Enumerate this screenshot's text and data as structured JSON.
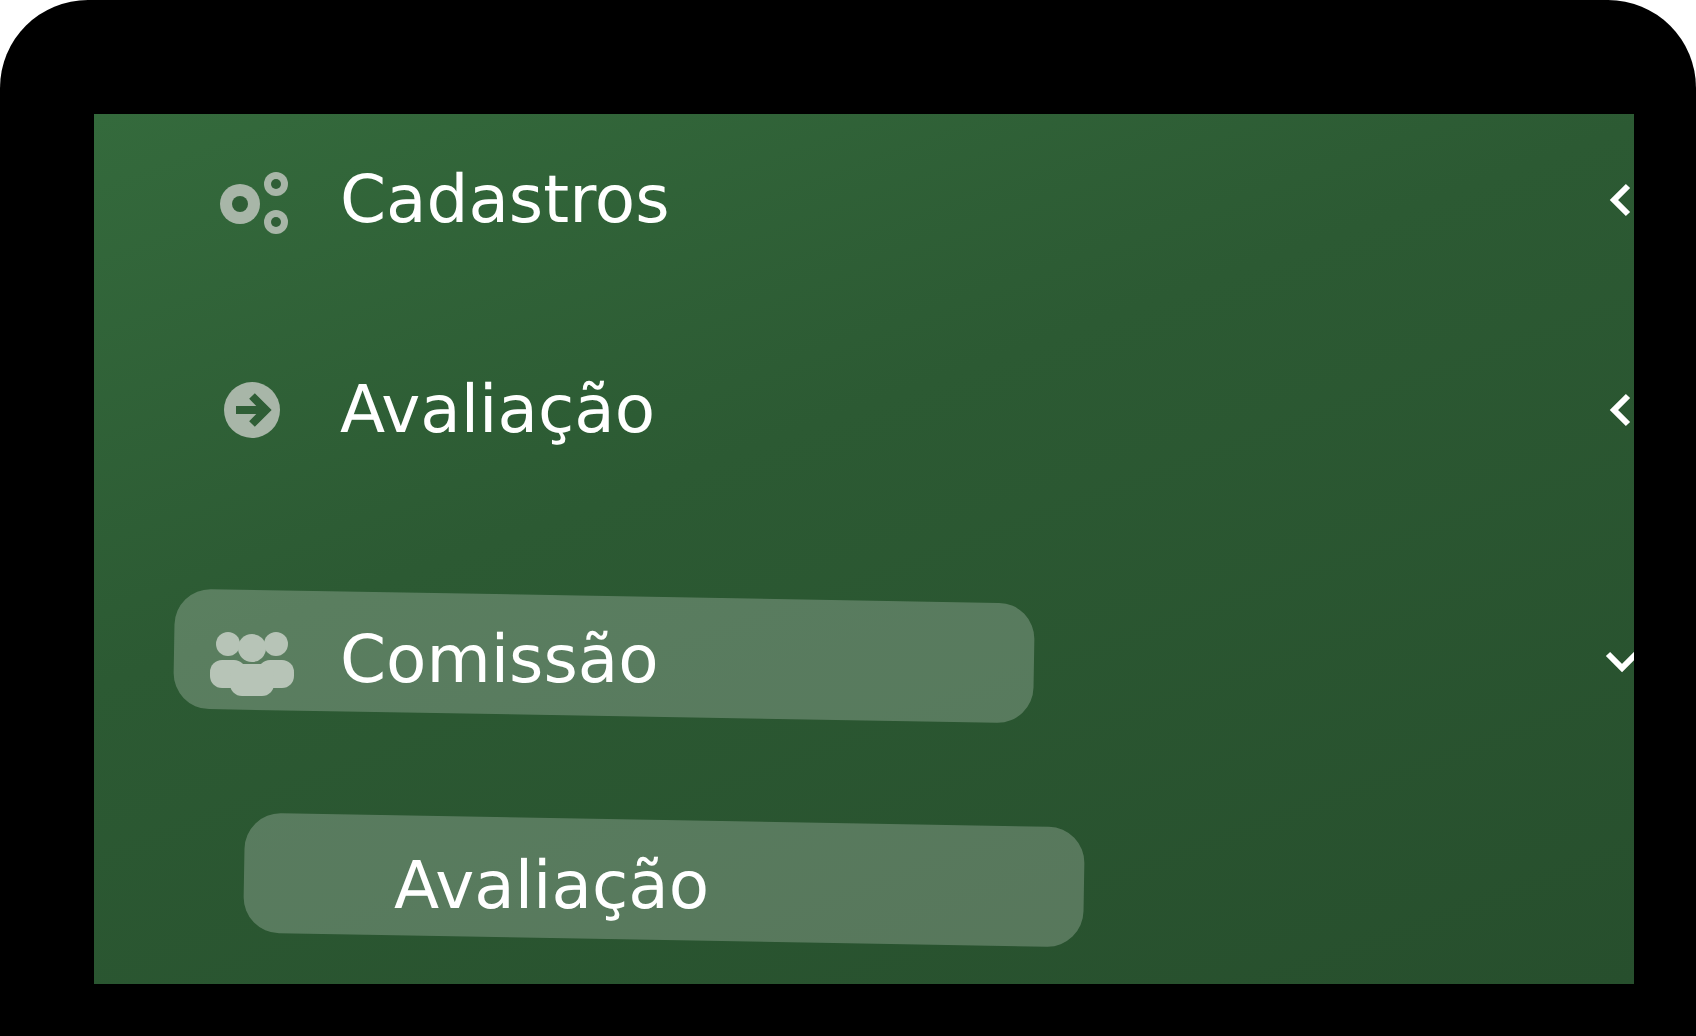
{
  "menu": [
    {
      "label": "Cadastros",
      "expanded": false,
      "selected": false
    },
    {
      "label": "Avaliação",
      "expanded": false,
      "selected": false
    },
    {
      "label": "Comissão",
      "expanded": true,
      "selected": true,
      "children": [
        {
          "label": "Avaliação",
          "selected": true
        }
      ]
    }
  ]
}
